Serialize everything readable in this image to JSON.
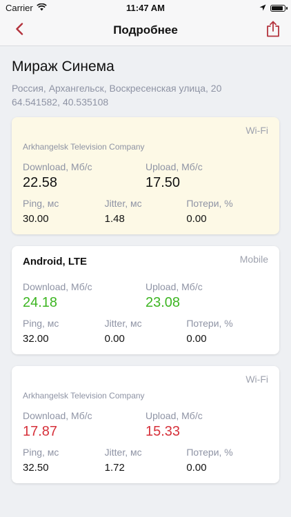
{
  "status_bar": {
    "carrier": "Carrier",
    "time": "11:47 AM"
  },
  "nav": {
    "title": "Подробнее",
    "back_icon": "chevron-left-icon",
    "share_icon": "share-icon",
    "accent": "#b3323c"
  },
  "place": {
    "name": "Мираж Синема",
    "address": "Россия, Архангельск, Воскресенская улица, 20",
    "coords": "64.541582, 40.535108"
  },
  "labels": {
    "download": "Download, Мб/с",
    "upload": "Upload, Мб/с",
    "ping": "Ping, мс",
    "jitter": "Jitter, мс",
    "loss": "Потери, %"
  },
  "colors": {
    "good": "#3cb521",
    "bad": "#d6303a",
    "neutral": "#111111",
    "highlight_bg": "#fdf9e6"
  },
  "cards": [
    {
      "type": "Wi-Fi",
      "provider": "Arkhangelsk Television Company",
      "download": "22.58",
      "upload": "17.50",
      "ping": "30.00",
      "jitter": "1.48",
      "loss": "0.00"
    },
    {
      "type": "Mobile",
      "device": "Android, LTE",
      "download": "24.18",
      "upload": "23.08",
      "ping": "32.00",
      "jitter": "0.00",
      "loss": "0.00"
    },
    {
      "type": "Wi-Fi",
      "provider": "Arkhangelsk Television Company",
      "download": "17.87",
      "upload": "15.33",
      "ping": "32.50",
      "jitter": "1.72",
      "loss": "0.00"
    }
  ]
}
